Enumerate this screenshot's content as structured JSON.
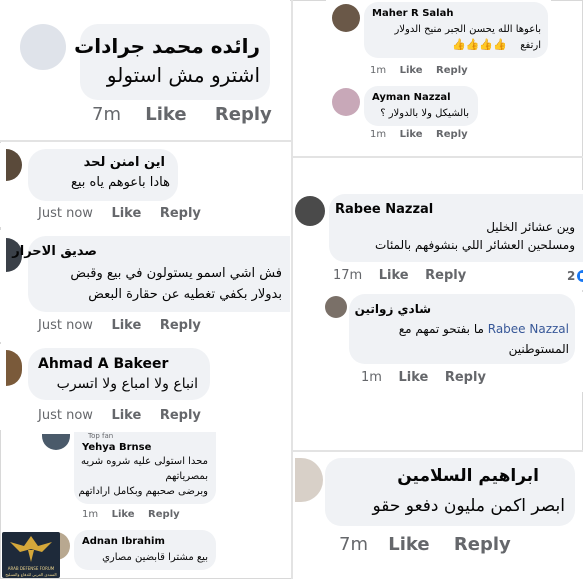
{
  "comments": [
    {
      "id": "c1",
      "name": "رائده محمد جرادات",
      "text": [
        "اشترو مش استولو"
      ],
      "time": "7m",
      "like": "Like",
      "reply": "Reply"
    },
    {
      "id": "c2",
      "name": "اين امنن لحد",
      "text": [
        "هادا باعوهم ياه بيع"
      ],
      "time": "Just now",
      "like": "Like",
      "reply": "Reply"
    },
    {
      "id": "c3",
      "name": "صديق الاحرار",
      "text": [
        "فش اشي اسمو يستولون في بيع وقبض",
        "بدولار بكفي تغطيه عن حقارة البعض"
      ],
      "time": "Just now",
      "like": "Like",
      "reply": "Reply"
    },
    {
      "id": "c4",
      "name": "Ahmad A Bakeer",
      "text": [
        "انباع ولا امباع ولا اتسرب"
      ],
      "time": "Just now",
      "like": "Like",
      "reply": "Reply"
    },
    {
      "id": "c5",
      "top_fan": "Top fan",
      "name": "Yehya Brnse",
      "text": [
        "محدا استولى عليه شروه شريه",
        "بمصرياتهم",
        "وبرضى صحبهم وبكامل اراداتهم"
      ],
      "time": "1m",
      "like": "Like",
      "reply": "Reply"
    },
    {
      "id": "c6",
      "name": "Adnan Ibrahim",
      "text": [
        "بيع مشترا قابضين مصاري"
      ]
    },
    {
      "id": "c7",
      "name": "Maher R Salah",
      "text": [
        "باعوها الله يحسن الجبر منيح الدولار",
        "ارتفع"
      ],
      "emoji": "👍👍👍👍",
      "time": "1m",
      "like": "Like",
      "reply": "Reply"
    },
    {
      "id": "c8",
      "name": "Ayman Nazzal",
      "text": [
        "بالشيكل ولا بالدولار ؟"
      ],
      "time": "1m",
      "like": "Like",
      "reply": "Reply"
    },
    {
      "id": "c9",
      "name": "Rabee Nazzal",
      "text": [
        "وين عشائر الخليل",
        "ومسلحين العشائر اللي بنشوفهم بالمئات"
      ],
      "time": "17m",
      "like": "Like",
      "reply": "Reply",
      "reactions": "2"
    },
    {
      "id": "c10",
      "name": "شادي زواتين",
      "mention": "Rabee Nazzal",
      "text": [
        "ما بفتحو تمهم مع",
        "المستوطنين"
      ],
      "time": "1m",
      "like": "Like",
      "reply": "Reply"
    },
    {
      "id": "c11",
      "name": "ابراهيم السلامين",
      "text": [
        "ابصر اكمن مليون دفعو حقو"
      ],
      "time": "7m",
      "like": "Like",
      "reply": "Reply"
    }
  ],
  "logo": {
    "line1": "ARAB DEFENSE FORUM",
    "line2": "المنتدى العربي للدفاع والتسليح"
  }
}
